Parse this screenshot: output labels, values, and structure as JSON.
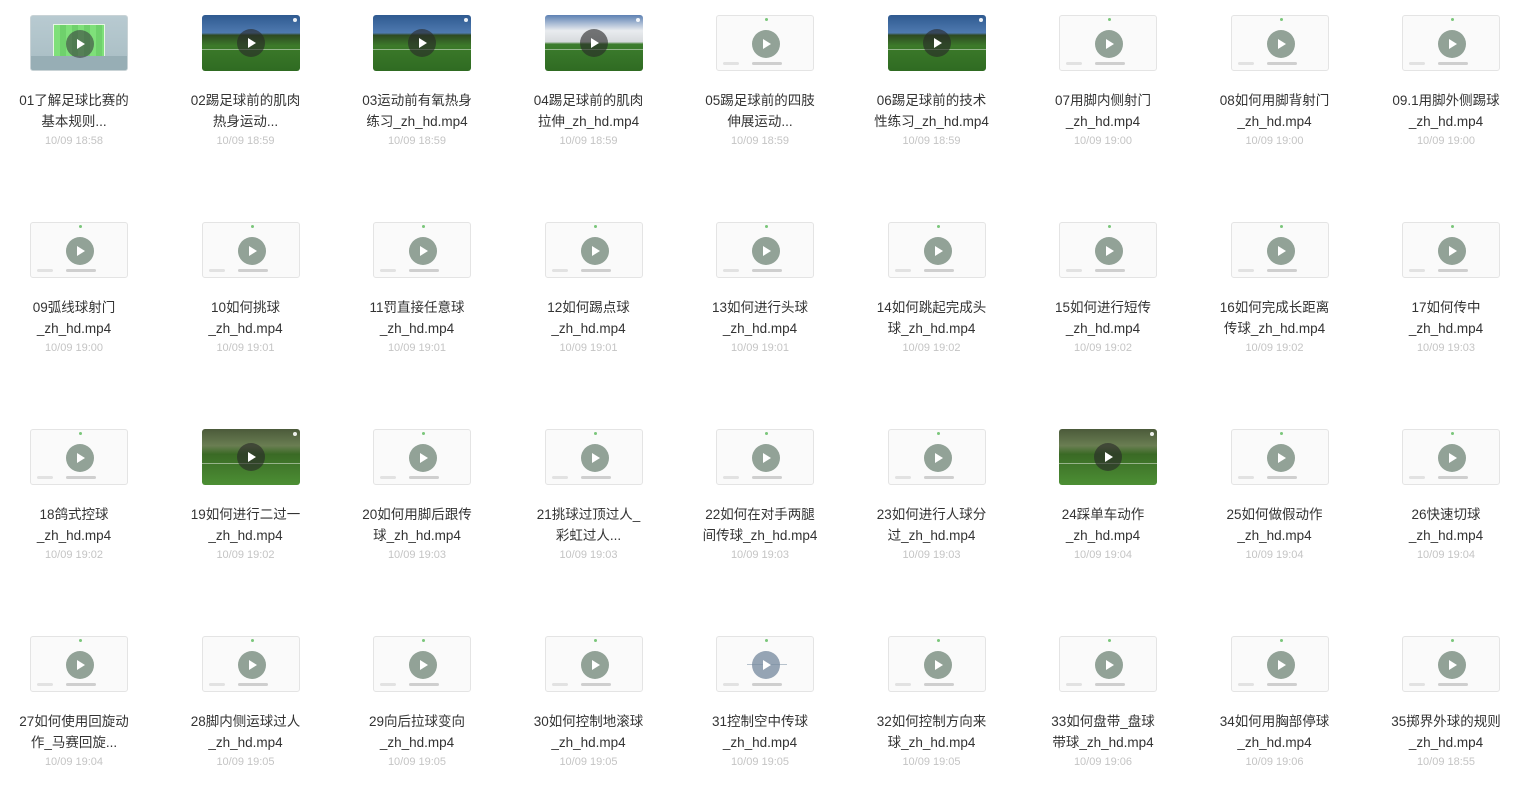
{
  "files": [
    {
      "name": "01了解足球比赛的\n基本规则...",
      "time": "10/09 18:58",
      "thumb": "pitch"
    },
    {
      "name": "02踢足球前的肌肉\n热身运动...",
      "time": "10/09 18:59",
      "thumb": "video"
    },
    {
      "name": "03运动前有氧热身\n练习_zh_hd.mp4",
      "time": "10/09 18:59",
      "thumb": "video"
    },
    {
      "name": "04踢足球前的肌肉\n拉伸_zh_hd.mp4",
      "time": "10/09 18:59",
      "thumb": "video-wall"
    },
    {
      "name": "05踢足球前的四肢\n伸展运动...",
      "time": "10/09 18:59",
      "thumb": "blank"
    },
    {
      "name": "06踢足球前的技术\n性练习_zh_hd.mp4",
      "time": "10/09 18:59",
      "thumb": "video"
    },
    {
      "name": "07用脚内侧射门\n_zh_hd.mp4",
      "time": "10/09 19:00",
      "thumb": "blank"
    },
    {
      "name": "08如何用脚背射门\n_zh_hd.mp4",
      "time": "10/09 19:00",
      "thumb": "blank"
    },
    {
      "name": "09.1用脚外侧踢球\n_zh_hd.mp4",
      "time": "10/09 19:00",
      "thumb": "blank"
    },
    {
      "name": "09弧线球射门\n_zh_hd.mp4",
      "time": "10/09 19:00",
      "thumb": "blank"
    },
    {
      "name": "10如何挑球\n_zh_hd.mp4",
      "time": "10/09 19:01",
      "thumb": "blank"
    },
    {
      "name": "11罚直接任意球\n_zh_hd.mp4",
      "time": "10/09 19:01",
      "thumb": "blank"
    },
    {
      "name": "12如何踢点球\n_zh_hd.mp4",
      "time": "10/09 19:01",
      "thumb": "blank"
    },
    {
      "name": "13如何进行头球\n_zh_hd.mp4",
      "time": "10/09 19:01",
      "thumb": "blank"
    },
    {
      "name": "14如何跳起完成头\n球_zh_hd.mp4",
      "time": "10/09 19:02",
      "thumb": "blank"
    },
    {
      "name": "15如何进行短传\n_zh_hd.mp4",
      "time": "10/09 19:02",
      "thumb": "blank"
    },
    {
      "name": "16如何完成长距离\n传球_zh_hd.mp4",
      "time": "10/09 19:02",
      "thumb": "blank"
    },
    {
      "name": "17如何传中\n_zh_hd.mp4",
      "time": "10/09 19:03",
      "thumb": "blank"
    },
    {
      "name": "18鸽式控球\n_zh_hd.mp4",
      "time": "10/09 19:02",
      "thumb": "blank"
    },
    {
      "name": "19如何进行二过一\n_zh_hd.mp4",
      "time": "10/09 19:02",
      "thumb": "video-trees"
    },
    {
      "name": "20如何用脚后跟传\n球_zh_hd.mp4",
      "time": "10/09 19:03",
      "thumb": "blank"
    },
    {
      "name": "21挑球过顶过人_\n彩虹过人...",
      "time": "10/09 19:03",
      "thumb": "blank"
    },
    {
      "name": "22如何在对手两腿\n间传球_zh_hd.mp4",
      "time": "10/09 19:03",
      "thumb": "blank"
    },
    {
      "name": "23如何进行人球分\n过_zh_hd.mp4",
      "time": "10/09 19:03",
      "thumb": "blank"
    },
    {
      "name": "24踩单车动作\n_zh_hd.mp4",
      "time": "10/09 19:04",
      "thumb": "video-trees"
    },
    {
      "name": "25如何做假动作\n_zh_hd.mp4",
      "time": "10/09 19:04",
      "thumb": "blank"
    },
    {
      "name": "26快速切球\n_zh_hd.mp4",
      "time": "10/09 19:04",
      "thumb": "blank"
    },
    {
      "name": "27如何使用回旋动\n作_马赛回旋...",
      "time": "10/09 19:04",
      "thumb": "blank"
    },
    {
      "name": "28脚内侧运球过人\n_zh_hd.mp4",
      "time": "10/09 19:05",
      "thumb": "blank"
    },
    {
      "name": "29向后拉球变向\n_zh_hd.mp4",
      "time": "10/09 19:05",
      "thumb": "blank"
    },
    {
      "name": "30如何控制地滚球\n_zh_hd.mp4",
      "time": "10/09 19:05",
      "thumb": "blank"
    },
    {
      "name": "31控制空中传球\n_zh_hd.mp4",
      "time": "10/09 19:05",
      "thumb": "blank-blue"
    },
    {
      "name": "32如何控制方向来\n球_zh_hd.mp4",
      "time": "10/09 19:05",
      "thumb": "blank"
    },
    {
      "name": "33如何盘带_盘球\n带球_zh_hd.mp4",
      "time": "10/09 19:06",
      "thumb": "blank"
    },
    {
      "name": "34如何用胸部停球\n_zh_hd.mp4",
      "time": "10/09 19:06",
      "thumb": "blank"
    },
    {
      "name": "35掷界外球的规则\n_zh_hd.mp4",
      "time": "10/09 18:55",
      "thumb": "blank"
    }
  ]
}
